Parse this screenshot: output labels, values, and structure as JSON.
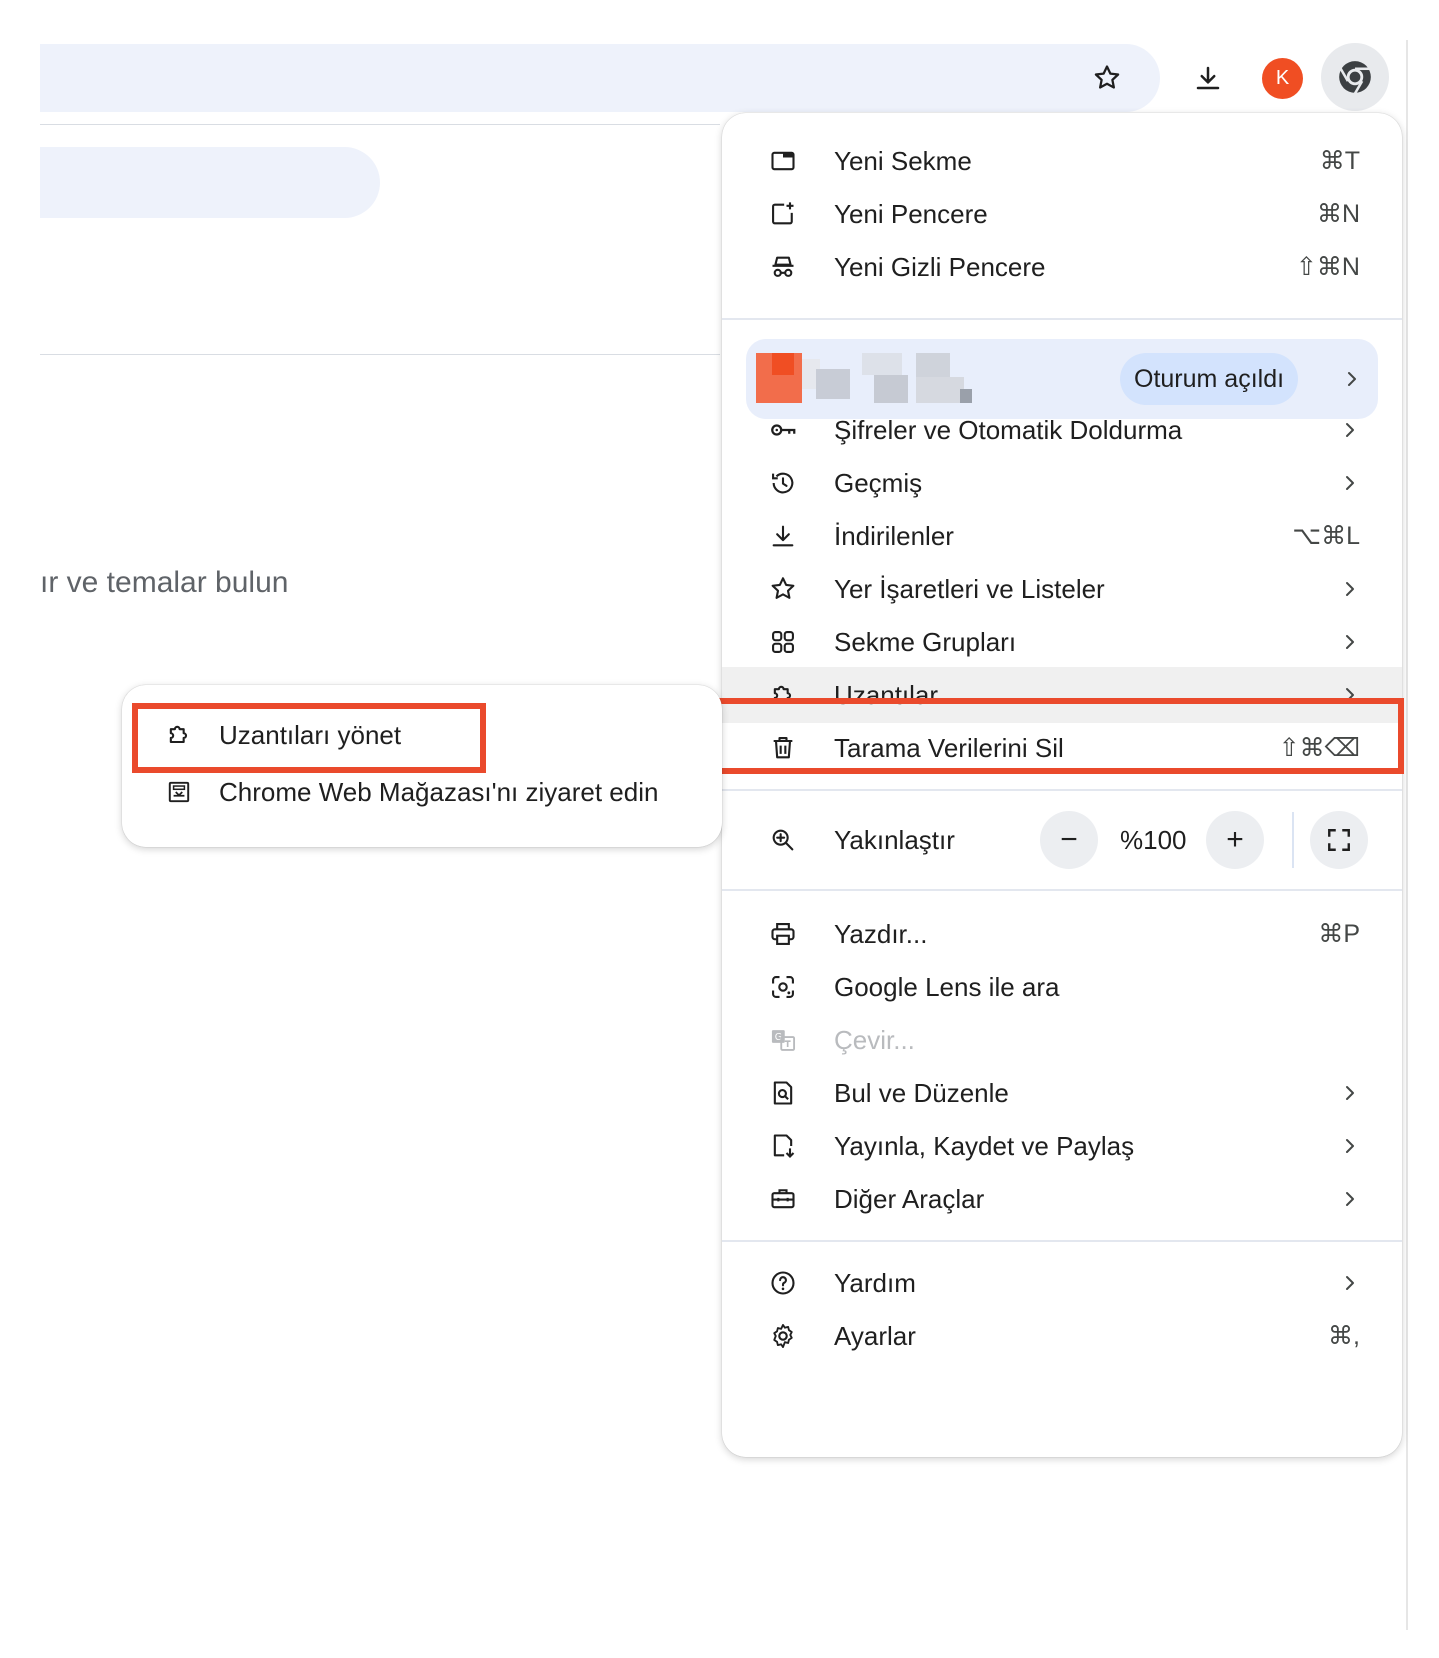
{
  "colors": {
    "accent_red": "#ea4a2c",
    "avatar": "#f04e23",
    "chip": "#d3e3fd",
    "menu_hover": "#f0f0f0"
  },
  "background": {
    "heading_fragment": "ır ve temalar bulun"
  },
  "toolbar": {
    "avatar_letter": "K",
    "icons": [
      "star-icon",
      "download-icon",
      "chrome-icon"
    ]
  },
  "menu": {
    "group1": [
      {
        "label": "Yeni Sekme",
        "shortcut": "⌘T",
        "icon": "new-tab-icon"
      },
      {
        "label": "Yeni Pencere",
        "shortcut": "⌘N",
        "icon": "new-window-icon"
      },
      {
        "label": "Yeni Gizli Pencere",
        "shortcut": "⇧⌘N",
        "icon": "incognito-icon"
      }
    ],
    "profile": {
      "status": "Oturum açıldı"
    },
    "group2": [
      {
        "label": "Şifreler ve Otomatik Doldurma",
        "icon": "key-icon",
        "submenu": true
      },
      {
        "label": "Geçmiş",
        "icon": "history-icon",
        "submenu": true
      },
      {
        "label": "İndirilenler",
        "shortcut": "⌥⌘L",
        "icon": "download-icon"
      },
      {
        "label": "Yer İşaretleri ve Listeler",
        "icon": "star-icon",
        "submenu": true
      },
      {
        "label": "Sekme Grupları",
        "icon": "tab-groups-icon",
        "submenu": true
      },
      {
        "label": "Uzantılar",
        "icon": "puzzle-icon",
        "submenu": true,
        "highlighted": true
      },
      {
        "label": "Tarama Verilerini Sil",
        "shortcut": "⇧⌘⌫",
        "icon": "trash-icon"
      }
    ],
    "zoom": {
      "label": "Yakınlaştır",
      "value": "%100",
      "minus": "−",
      "plus": "+"
    },
    "group3": [
      {
        "label": "Yazdır...",
        "shortcut": "⌘P",
        "icon": "print-icon"
      },
      {
        "label": "Google Lens ile ara",
        "icon": "lens-icon"
      },
      {
        "label": "Çevir...",
        "icon": "translate-icon",
        "disabled": true
      },
      {
        "label": "Bul ve Düzenle",
        "icon": "find-icon",
        "submenu": true
      },
      {
        "label": "Yayınla, Kaydet ve Paylaş",
        "icon": "cast-save-share-icon",
        "submenu": true
      },
      {
        "label": "Diğer Araçlar",
        "icon": "toolbox-icon",
        "submenu": true
      }
    ],
    "group4": [
      {
        "label": "Yardım",
        "icon": "help-icon",
        "submenu": true
      },
      {
        "label": "Ayarlar",
        "shortcut": "⌘,",
        "icon": "gear-icon"
      }
    ]
  },
  "submenu": {
    "items": [
      {
        "label": "Uzantıları yönet",
        "icon": "puzzle-icon",
        "highlighted": true
      },
      {
        "label": "Chrome Web Mağazası'nı ziyaret edin",
        "icon": "web-store-icon"
      }
    ]
  }
}
